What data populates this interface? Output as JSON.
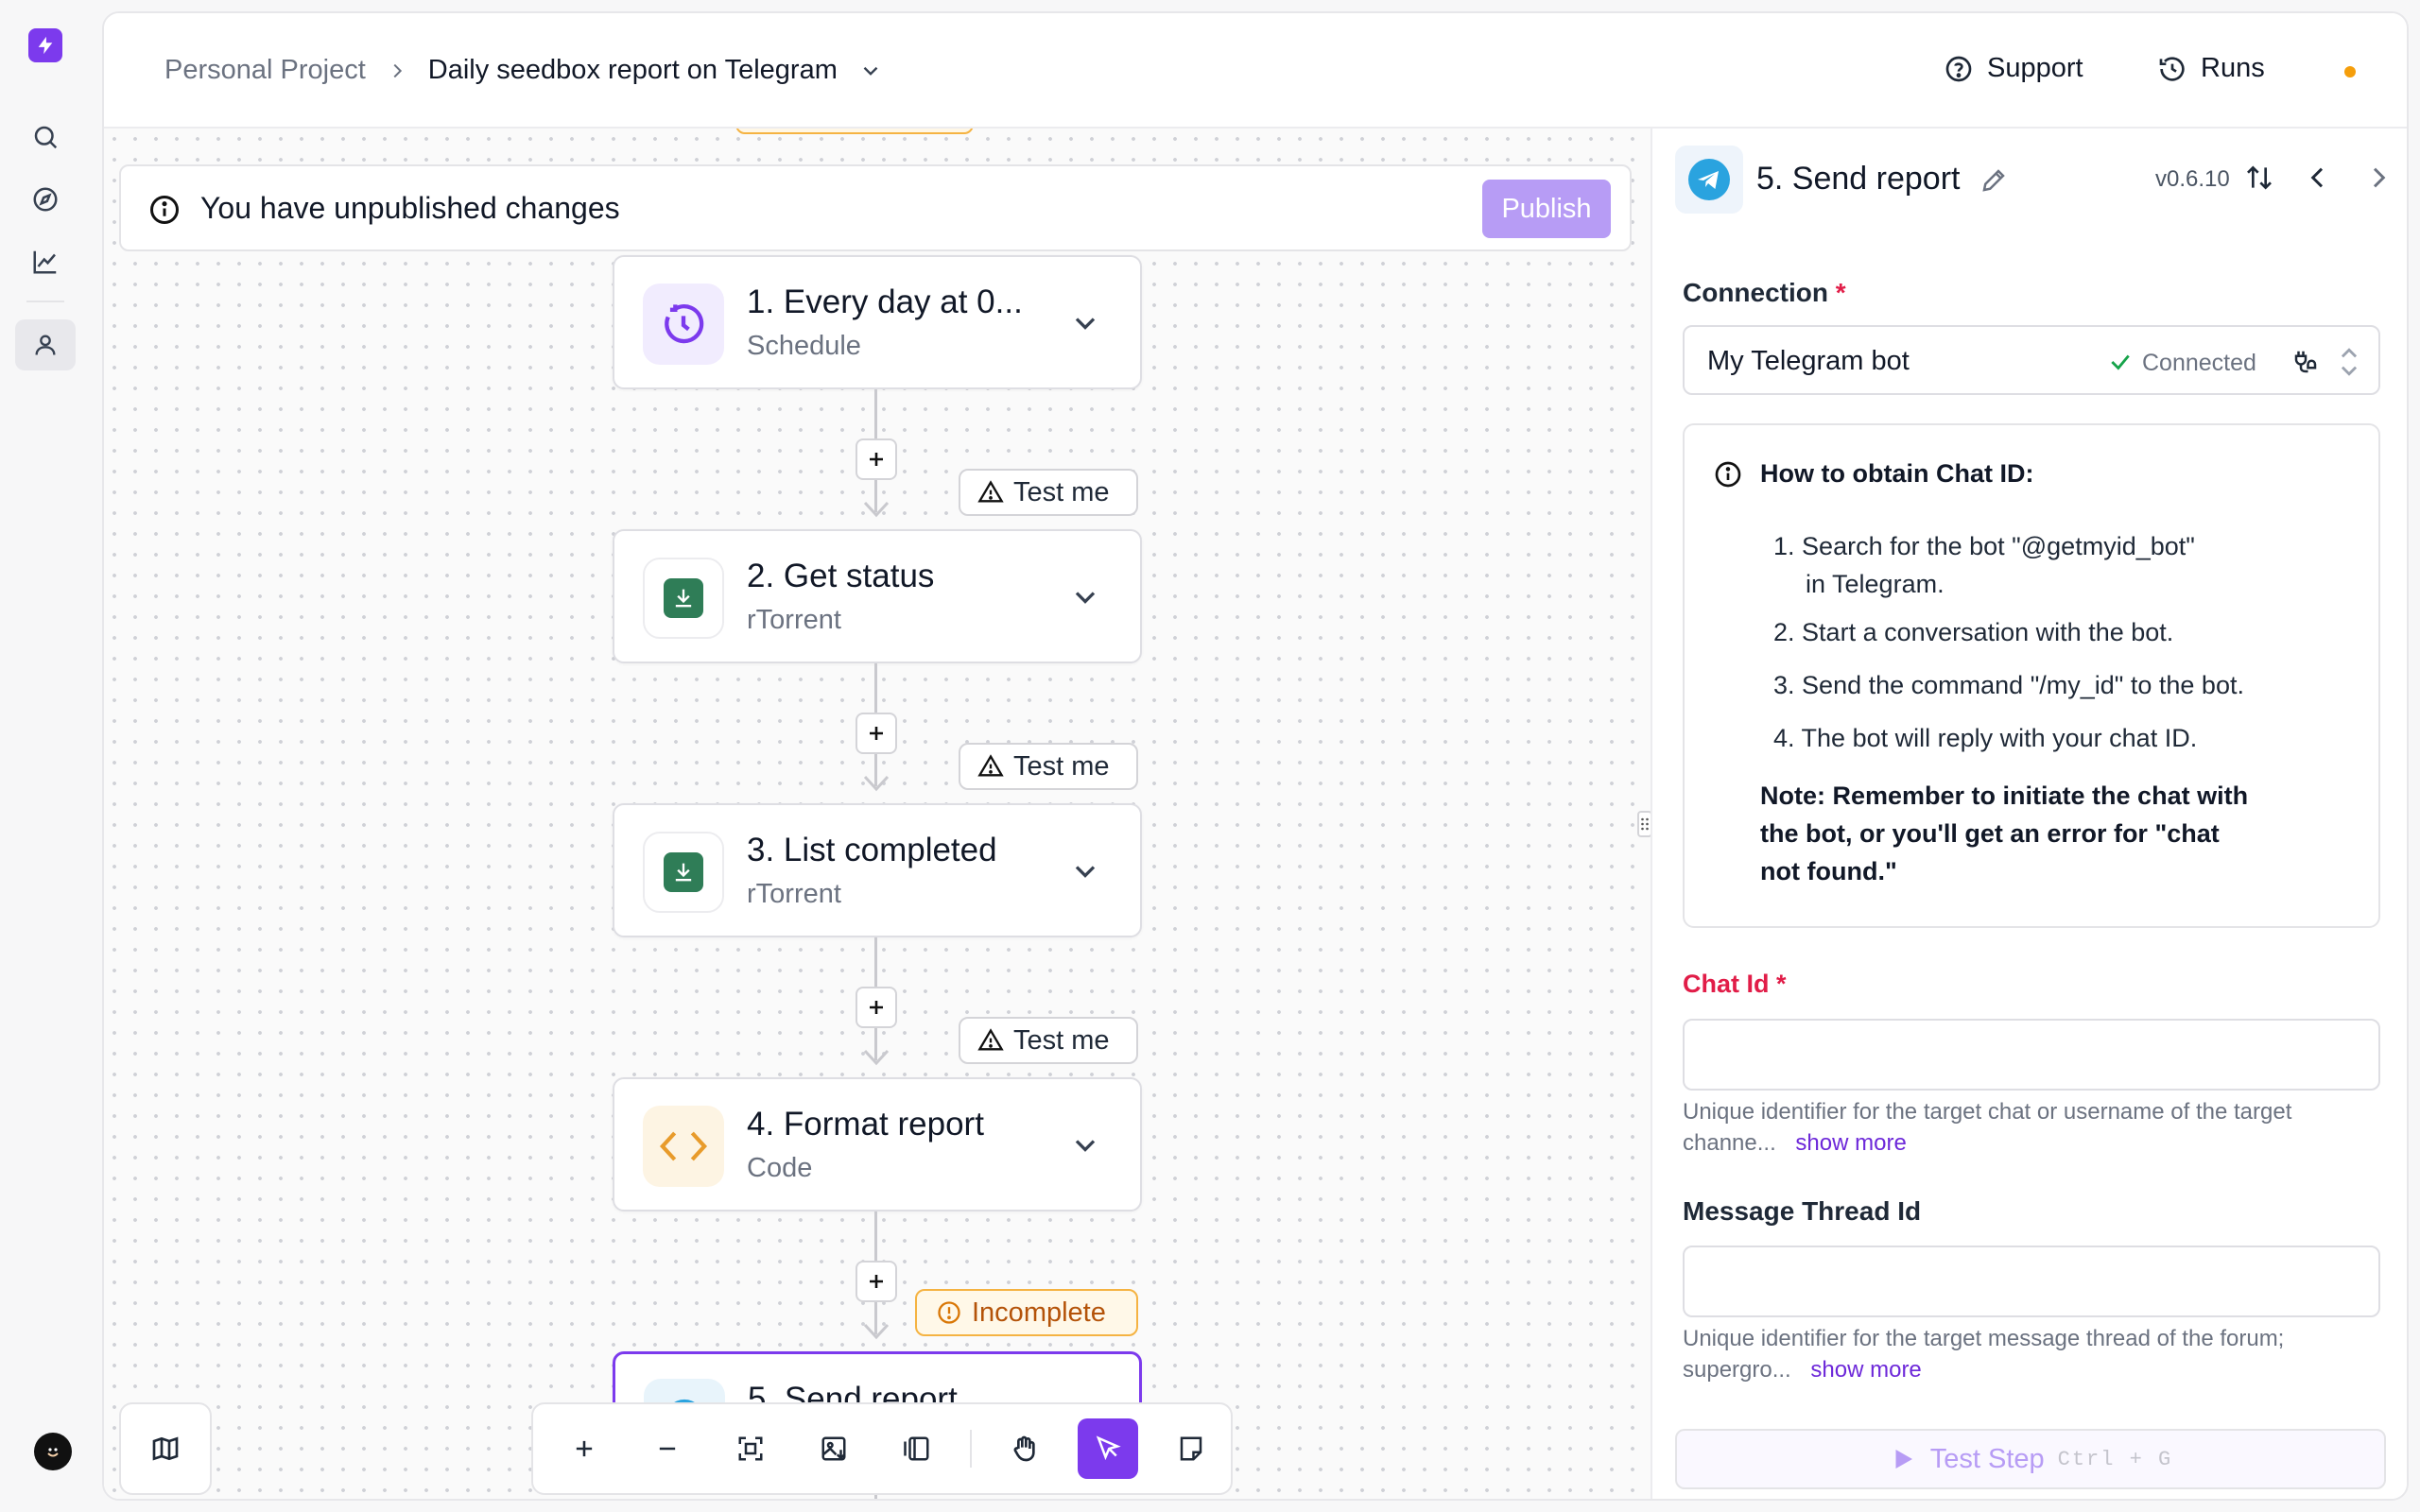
{
  "breadcrumb": {
    "project": "Personal Project",
    "flow": "Daily seedbox report on Telegram"
  },
  "topbar": {
    "support": "Support",
    "runs": "Runs",
    "status_dot_color": "#f59e0b"
  },
  "banner": {
    "text": "You have unpublished changes",
    "publish": "Publish"
  },
  "steps": [
    {
      "title": "1. Every day at 0...",
      "subtitle": "Schedule",
      "icon": "schedule-icon"
    },
    {
      "title": "2. Get status",
      "subtitle": "rTorrent",
      "icon": "rtorrent-icon",
      "badge": "Test me"
    },
    {
      "title": "3. List completed",
      "subtitle": "rTorrent",
      "icon": "rtorrent-icon",
      "badge": "Test me"
    },
    {
      "title": "4. Format report",
      "subtitle": "Code",
      "icon": "code-icon",
      "badge": "Test me"
    },
    {
      "title": "5. Send report",
      "icon": "telegram-icon",
      "badge": "Incomplete"
    }
  ],
  "panel": {
    "title": "5. Send report",
    "version": "v0.6.10",
    "connection": {
      "label": "Connection",
      "required_mark": "*",
      "value": "My Telegram bot",
      "status": "Connected"
    },
    "help": {
      "title": "How to obtain Chat ID:",
      "steps": [
        "Search for the bot \"@getmyid_bot\"",
        "in Telegram.",
        "Start a conversation with the bot.",
        "Send the command \"/my_id\" to the bot.",
        "The bot will reply with your chat ID."
      ],
      "numbers": [
        "1.",
        "2.",
        "3.",
        "4."
      ],
      "note_lines": [
        "Note: Remember to initiate the chat with",
        "the bot, or you'll get an error for \"chat",
        "not found.\""
      ]
    },
    "chat_id": {
      "label": "Chat Id",
      "required_mark": "*",
      "value": "",
      "hint_line1": "Unique identifier for the target chat or username of the target",
      "hint_line2": "channe...",
      "show_more": "show more"
    },
    "thread_id": {
      "label": "Message Thread Id",
      "value": "",
      "hint_line1": "Unique identifier for the target message thread of the forum;",
      "hint_line2": "supergro...",
      "show_more": "show more"
    },
    "test_step": {
      "label": "Test Step",
      "shortcut": "Ctrl + G"
    }
  },
  "colors": {
    "accent": "#8b5cf6",
    "warning": "#f59e0b",
    "required": "#e11d48",
    "telegram": "#2aa3df",
    "rtorrent": "#2f7d57"
  }
}
